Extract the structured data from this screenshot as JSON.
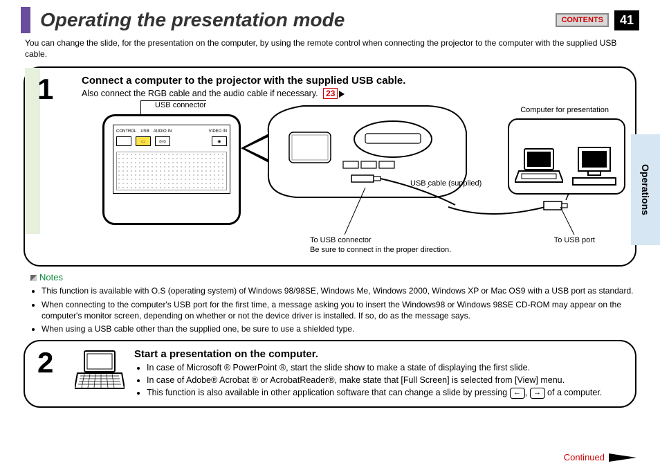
{
  "header": {
    "title": "Operating the presentation mode",
    "contents_btn": "CONTENTS",
    "page_number": "41"
  },
  "side_tab": "Operations",
  "intro": "You can change the slide, for the presentation on the computer, by using the remote control when connecting the projector to the computer with the supplied USB cable.",
  "step1": {
    "num": "1",
    "title": "Connect a computer to the projector with the supplied USB cable.",
    "subtitle": "Also connect the RGB cable and the audio cable if necessary.",
    "ref": "23",
    "labels": {
      "usb_connector": "USB connector",
      "computer_for_presentation": "Computer for presentation",
      "usb_cable": "USB cable (supplied)",
      "to_usb_connector": "To USB connector",
      "proper_direction": "Be sure to connect in the proper direction.",
      "to_usb_port": "To USB port",
      "ports": {
        "control": "CONTROL",
        "usb": "USB",
        "audio": "AUDIO IN",
        "video": "VIDEO IN"
      }
    }
  },
  "notes": {
    "heading": "Notes",
    "items": [
      "This function is available with O.S (operating system) of Windows 98/98SE, Windows Me, Windows 2000, Windows XP or Mac OS9 with a USB port as standard.",
      "When connecting to the computer's USB port for the first time, a message asking you to insert the Windows98 or Windows 98SE CD-ROM may appear on the computer's monitor screen, depending on whether or not the device driver is installed. If so, do as the message says.",
      "When using a USB cable other than the supplied one, be sure to use a shielded type."
    ]
  },
  "step2": {
    "num": "2",
    "title": "Start a presentation on the computer.",
    "bullets": {
      "b1": "In case of Microsoft ® PowerPoint ®, start the slide show to make a state of displaying the first slide.",
      "b2": "In case of Adobe® Acrobat ® or AcrobatReader®, make state that [Full Screen] is selected from [View] menu.",
      "b3a": "This function is also available in other application software that can change a slide by pressing ",
      "b3b": ", ",
      "b3c": " of a computer."
    },
    "keys": {
      "left": "←",
      "right": "→"
    }
  },
  "footer": {
    "continued": "Continued"
  }
}
